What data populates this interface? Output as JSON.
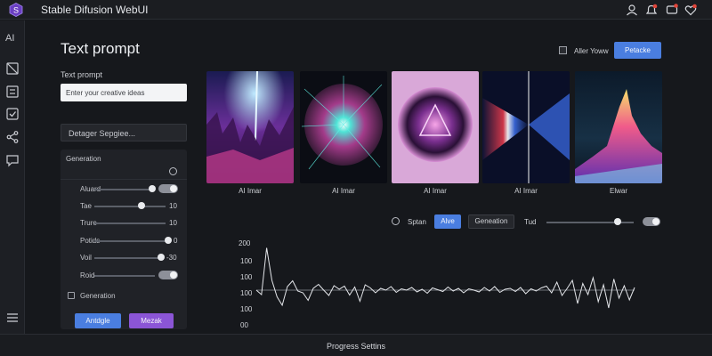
{
  "app": {
    "title": "Stable Difusion WebUI"
  },
  "sidebar": {
    "top_label": "AI"
  },
  "main": {
    "title": "Text prompt",
    "prompt_label": "Text prompt",
    "prompt_placeholder": "Enter your creative ideas",
    "design_select": "Detager Sepgiee..."
  },
  "generation": {
    "title": "Generation",
    "rows": [
      {
        "label": "Aluard",
        "control": "slider-toggle",
        "level": 0.9
      },
      {
        "label": "Tae",
        "value": "10",
        "level": 0.6
      },
      {
        "label": "Trure",
        "value": "10",
        "level": 0.0
      },
      {
        "label": "Potids",
        "value": "0",
        "level": 1.0
      },
      {
        "label": "Voil",
        "value": "-30",
        "level": 0.85
      },
      {
        "label": "Roid",
        "control": "toggle"
      }
    ],
    "checkbox_label": "Generation",
    "primary_button": "Antdgle",
    "secondary_button": "Mezak"
  },
  "top_actions": {
    "checkbox_label": "Aller Yoww",
    "button": "Petacke"
  },
  "gallery": {
    "captions": [
      "AI Imar",
      "AI Imar",
      "AI Imar",
      "AI Imar",
      "Elwar"
    ]
  },
  "controls": {
    "option_label": "Sptan",
    "chip_active": "Alve",
    "chip_inactive": "Geneation",
    "slider_label": "Tud",
    "slider_level": 0.8
  },
  "chart_data": {
    "type": "line",
    "y_tick_labels": [
      "200",
      "100",
      "100",
      "100",
      "100",
      "00"
    ],
    "baseline_label": "100",
    "series": [
      {
        "values": [
          0,
          -10,
          95,
          22,
          -15,
          -34,
          8,
          21,
          -2,
          -6,
          -23,
          4,
          13,
          0,
          -12,
          10,
          2,
          9,
          -11,
          7,
          -25,
          12,
          5,
          -6,
          4,
          0,
          8,
          -5,
          3,
          0,
          6,
          -4,
          2,
          -7,
          5,
          1,
          -3,
          7,
          -2,
          4,
          -6,
          3,
          0,
          -4,
          6,
          -2,
          8,
          -5,
          2,
          4,
          -3,
          6,
          -8,
          3,
          -2,
          5,
          9,
          -6,
          18,
          -12,
          4,
          22,
          -30,
          15,
          -10,
          28,
          -26,
          12,
          -40,
          25,
          -18,
          10,
          -22,
          6
        ]
      }
    ],
    "grid": false
  },
  "footer": {
    "label": "Progress Settins"
  },
  "colors": {
    "accent_blue": "#4a7ee0",
    "accent_purple": "#8b55d6",
    "background": "#16181c"
  },
  "icons": [
    "app-logo-icon",
    "user-icon",
    "notification-icon",
    "heart-icon",
    "image-icon",
    "list-icon",
    "checkbox-icon",
    "share-icon",
    "chat-icon",
    "menu-icon"
  ]
}
